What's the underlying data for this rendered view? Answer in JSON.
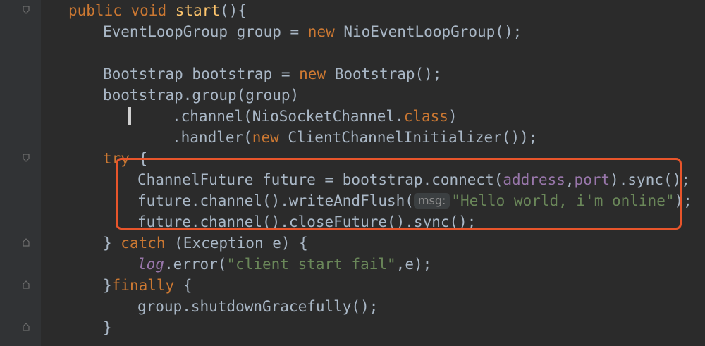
{
  "editor": {
    "language": "java",
    "lines": [
      {
        "tokens": [
          {
            "text": "public",
            "style": "kw"
          },
          {
            "text": " "
          },
          {
            "text": "void",
            "style": "kw"
          },
          {
            "text": " "
          },
          {
            "text": "start",
            "style": "fn"
          },
          {
            "text": "(){"
          }
        ]
      },
      {
        "tokens": [
          {
            "text": "EventLoopGroup group = "
          },
          {
            "text": "new",
            "style": "kw"
          },
          {
            "text": " NioEventLoopGroup();"
          }
        ]
      },
      {
        "tokens": []
      },
      {
        "tokens": [
          {
            "text": "Bootstrap bootstrap = "
          },
          {
            "text": "new",
            "style": "kw"
          },
          {
            "text": " Bootstrap();"
          }
        ]
      },
      {
        "tokens": [
          {
            "text": "bootstrap.group(group)"
          }
        ]
      },
      {
        "tokens": [
          {
            "text": ".channel(NioSocketChannel."
          },
          {
            "text": "class",
            "style": "kw"
          },
          {
            "text": ")"
          }
        ]
      },
      {
        "tokens": [
          {
            "text": ".handler("
          },
          {
            "text": "new",
            "style": "kw"
          },
          {
            "text": " ClientChannelInitializer());"
          }
        ]
      },
      {
        "tokens": [
          {
            "text": "try",
            "style": "kw"
          },
          {
            "text": " {"
          }
        ]
      },
      {
        "tokens": [
          {
            "text": "ChannelFuture future = bootstrap.connect("
          },
          {
            "text": "address",
            "style": "fld"
          },
          {
            "text": ","
          },
          {
            "text": "port",
            "style": "fld"
          },
          {
            "text": ").sync();"
          }
        ]
      },
      {
        "tokens": [
          {
            "text": "future.channel().writeAndFlush("
          },
          {
            "text": "msg:",
            "style": "hint"
          },
          {
            "text": "\"Hello world, i'm online\"",
            "style": "str"
          },
          {
            "text": ");"
          }
        ]
      },
      {
        "tokens": [
          {
            "text": "future.channel().closeFuture().sync();"
          }
        ]
      },
      {
        "tokens": [
          {
            "text": "} "
          },
          {
            "text": "catch",
            "style": "kw"
          },
          {
            "text": " (Exception e) {"
          }
        ]
      },
      {
        "tokens": [
          {
            "text": "log",
            "style": "log"
          },
          {
            "text": ".error("
          },
          {
            "text": "\"client start fail\"",
            "style": "str"
          },
          {
            "text": ",e);"
          }
        ]
      },
      {
        "tokens": [
          {
            "text": "}"
          },
          {
            "text": "finally",
            "style": "kw"
          },
          {
            "text": " {"
          }
        ]
      },
      {
        "tokens": [
          {
            "text": "group.shutdownGracefully();"
          }
        ]
      },
      {
        "tokens": [
          {
            "text": "}"
          }
        ]
      }
    ]
  },
  "colors": {
    "background": "#2b2b2b",
    "keyword": "#cc7832",
    "method": "#ffc66d",
    "string": "#6a8759",
    "field": "#9876aa",
    "highlight_box": "#e8552b"
  }
}
